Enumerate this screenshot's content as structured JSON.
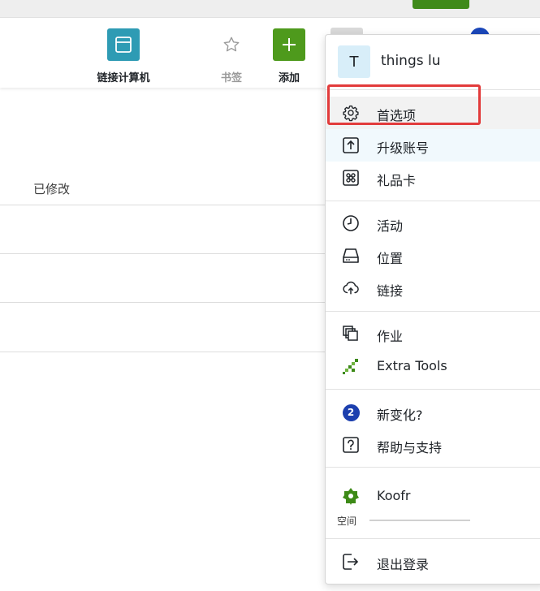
{
  "toolbar": {
    "connect_label": "链接计算机",
    "bookmark_label": "书签",
    "add_label": "添加"
  },
  "file_list": {
    "modified_header": "已修改"
  },
  "menu": {
    "user": {
      "initial": "T",
      "name": "things lu"
    },
    "items": {
      "preferences": "首选项",
      "upgrade": "升级账号",
      "gift_card": "礼品卡",
      "activity": "活动",
      "locations": "位置",
      "links": "链接",
      "jobs": "作业",
      "extra_tools": "Extra Tools",
      "whats_new": "新变化?",
      "whats_new_badge": "2",
      "help": "帮助与支持",
      "koofr": "Koofr",
      "space_label": "空间",
      "logout": "退出登录"
    }
  },
  "colors": {
    "accent_teal": "#2e9bb4",
    "accent_green": "#4e9a1c",
    "highlight_red": "#e23b3b",
    "badge_blue": "#1c3fae"
  }
}
